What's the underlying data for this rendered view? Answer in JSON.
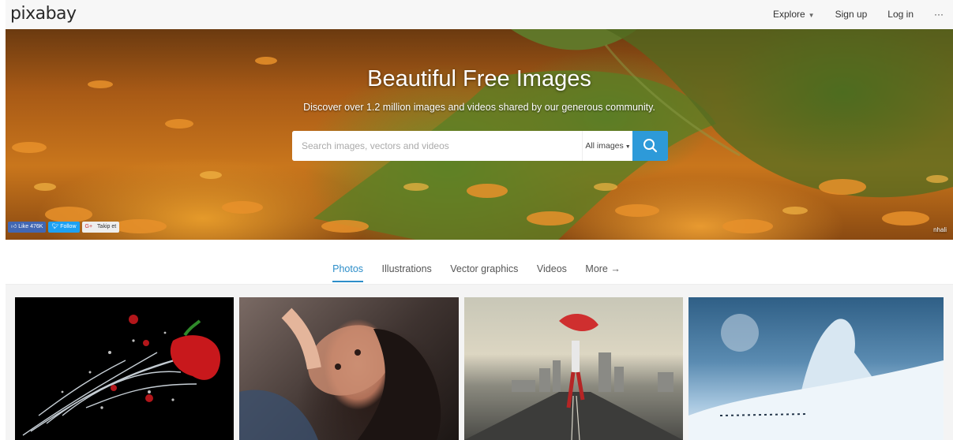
{
  "header": {
    "logo": "pixabay",
    "nav": {
      "explore": "Explore",
      "signup": "Sign up",
      "login": "Log in",
      "more": "···"
    }
  },
  "hero": {
    "title": "Beautiful Free Images",
    "subtitle": "Discover over 1.2 million images and videos shared by our generous community.",
    "search_placeholder": "Search images, vectors and videos",
    "search_value": "",
    "filter_label": "All images",
    "social": {
      "like": "Like 476K",
      "follow": "Follow",
      "gplus": "G+",
      "takip": "Takip et"
    },
    "credit": "nhali"
  },
  "tabs": [
    {
      "label": "Photos",
      "active": true
    },
    {
      "label": "Illustrations",
      "active": false
    },
    {
      "label": "Vector graphics",
      "active": false
    },
    {
      "label": "Videos",
      "active": false
    },
    {
      "label": "More →",
      "active": false
    }
  ],
  "colors": {
    "accent": "#2d9ad9",
    "active_tab": "#2d8ec9",
    "topbar": "#f7f7f7"
  },
  "icons": {
    "search": "search-icon",
    "caret": "chevron-down-icon",
    "like": "thumbs-up-icon",
    "twitter": "twitter-bird-icon"
  }
}
